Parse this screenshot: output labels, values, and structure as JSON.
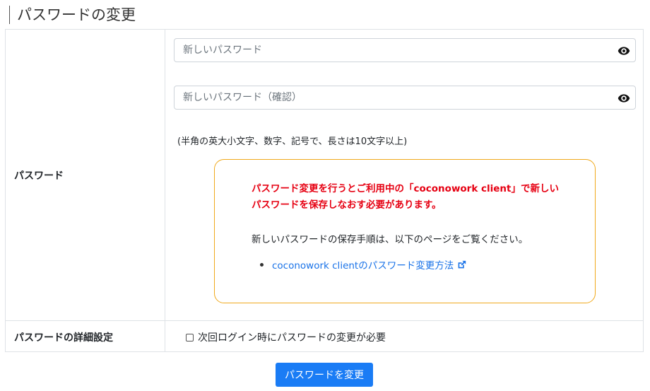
{
  "page": {
    "title": "パスワードの変更"
  },
  "form": {
    "password_label": "パスワード",
    "new_password_placeholder": "新しいパスワード",
    "confirm_password_placeholder": "新しいパスワード（確認）",
    "hint": "(半角の英大小文字、数字、記号で、長さは10文字以上)",
    "notice": {
      "warning": "パスワード変更を行うとご利用中の「coconowork client」で新しいパスワードを保存しなおす必要があります。",
      "procedure_text": "新しいパスワードの保存手順は、以下のページをご覧ください。",
      "link_text": "coconowork clientのパスワード変更方法",
      "border_color": "#f0a91b",
      "warning_color": "#e60012",
      "link_color": "#1a73e8"
    },
    "detail_label": "パスワードの詳細設定",
    "require_change_label": "次回ログイン時にパスワードの変更が必要",
    "require_change_checked": false
  },
  "actions": {
    "submit_label": "パスワードを変更",
    "submit_color": "#1a7cf5"
  },
  "icons": {
    "visibility_toggle": "eye-icon",
    "external_link": "external-link-icon"
  }
}
